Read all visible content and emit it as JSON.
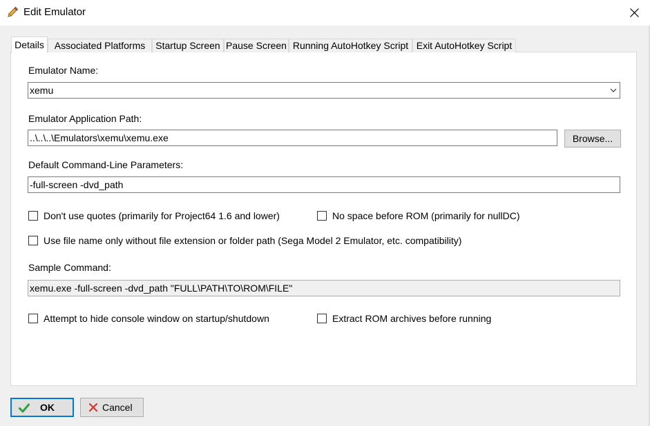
{
  "window": {
    "title": "Edit Emulator",
    "icon": "pencil-icon"
  },
  "tabs": [
    {
      "label": "Details",
      "active": true
    },
    {
      "label": "Associated Platforms"
    },
    {
      "label": "Startup Screen"
    },
    {
      "label": "Pause Screen"
    },
    {
      "label": "Running AutoHotkey Script"
    },
    {
      "label": "Exit AutoHotkey Script"
    }
  ],
  "details": {
    "name_label": "Emulator Name:",
    "name_value": "xemu",
    "path_label": "Emulator Application Path:",
    "path_value": "..\\..\\..\\Emulators\\xemu\\xemu.exe",
    "browse_label": "Browse...",
    "params_label": "Default Command-Line Parameters:",
    "params_value": "-full-screen -dvd_path",
    "no_quotes_label": "Don't use quotes (primarily for Project64 1.6 and lower)",
    "no_quotes_checked": false,
    "no_space_label": "No space before ROM (primarily for nullDC)",
    "no_space_checked": false,
    "filename_only_label": "Use file name only without file extension or folder path (Sega Model 2 Emulator, etc. compatibility)",
    "filename_only_checked": false,
    "sample_label": "Sample Command:",
    "sample_value": "xemu.exe -full-screen -dvd_path \"FULL\\PATH\\TO\\ROM\\FILE\"",
    "hide_console_label": "Attempt to hide console window on startup/shutdown",
    "hide_console_checked": false,
    "extract_label": "Extract ROM archives before running",
    "extract_checked": false
  },
  "buttons": {
    "ok": "OK",
    "cancel": "Cancel"
  },
  "colors": {
    "accent": "#0078d7",
    "ok_check": "#2e9e3f",
    "cancel_x": "#d9342b"
  }
}
